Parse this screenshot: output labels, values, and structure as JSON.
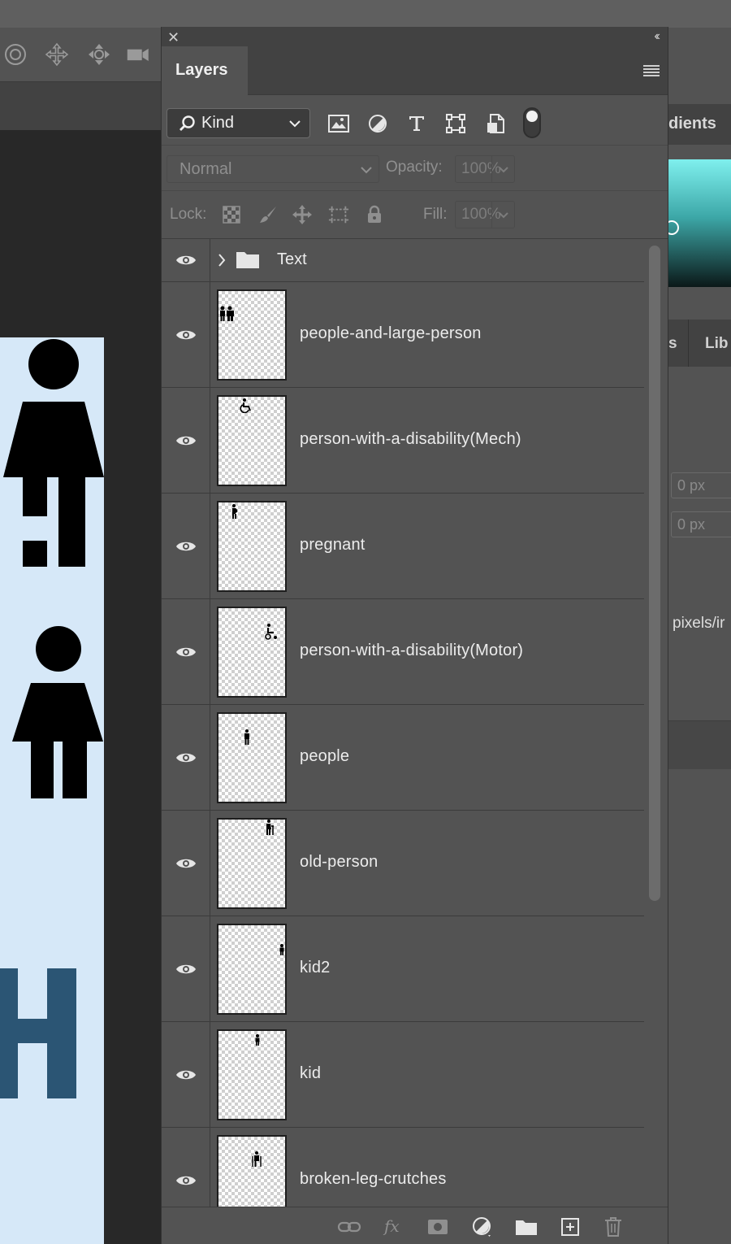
{
  "background_ui": {
    "right_panel_tab_partial": "dients",
    "right_panel_tabs_partial": [
      "s",
      "Lib"
    ],
    "right_fields": [
      "0 px",
      "0 px"
    ],
    "right_text_partial": "pixels/ir",
    "artboard_color": "#d6e8f8",
    "artboard_letter_color": "#2b5574"
  },
  "layers_panel": {
    "title": "Layers",
    "filter": {
      "kind_label": "Kind",
      "icons": [
        "image-filter-icon",
        "adjustment-filter-icon",
        "type-filter-icon",
        "shape-filter-icon",
        "smart-object-filter-icon"
      ]
    },
    "blend_mode": "Normal",
    "opacity_label": "Opacity:",
    "opacity_value": "100%",
    "lock_label": "Lock:",
    "fill_label": "Fill:",
    "fill_value": "100%",
    "group": {
      "name": "Text"
    },
    "layers": [
      {
        "name": "people-and-large-person",
        "thumb_icon": "people-and-large-person-icon"
      },
      {
        "name": "person-with-a-disability(Mech)",
        "thumb_icon": "wheelchair-icon"
      },
      {
        "name": "pregnant",
        "thumb_icon": "pregnant-icon"
      },
      {
        "name": "person-with-a-disability(Motor)",
        "thumb_icon": "motor-wheelchair-icon"
      },
      {
        "name": "people",
        "thumb_icon": "person-icon"
      },
      {
        "name": "old-person",
        "thumb_icon": "old-person-icon"
      },
      {
        "name": "kid2",
        "thumb_icon": "kid-icon"
      },
      {
        "name": "kid",
        "thumb_icon": "kid-icon"
      },
      {
        "name": "broken-leg-crutches",
        "thumb_icon": "crutches-icon"
      }
    ]
  }
}
